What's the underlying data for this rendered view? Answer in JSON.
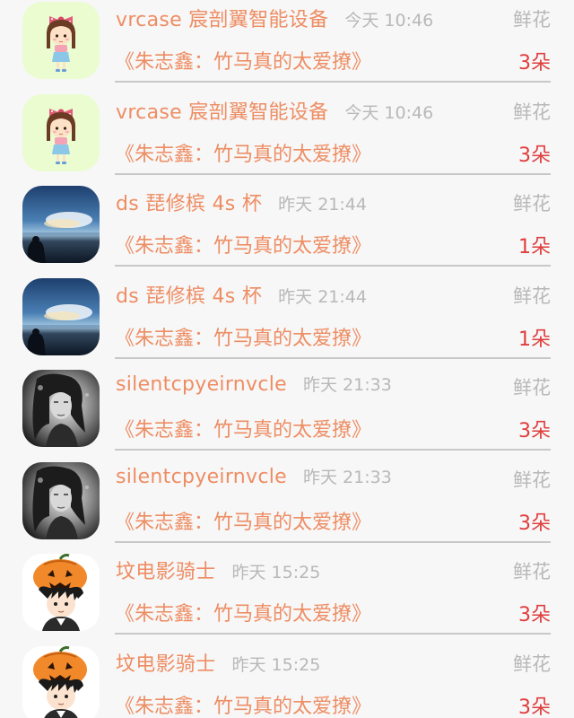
{
  "rows": [
    {
      "username": "vrcase 宸剖翼智能设备",
      "time": "今天 10:46",
      "gift": "鲜花",
      "article": "《朱志鑫：竹马真的太爱撩》",
      "count": "3朵",
      "avatar_icon": "cartoon-girl-icon"
    },
    {
      "username": "vrcase 宸剖翼智能设备",
      "time": "今天 10:46",
      "gift": "鲜花",
      "article": "《朱志鑫：竹马真的太爱撩》",
      "count": "3朵",
      "avatar_icon": "cartoon-girl-icon"
    },
    {
      "username": "ds 琵修槟 4s 杯",
      "time": "昨天 21:44",
      "gift": "鲜花",
      "article": "《朱志鑫：竹马真的太爱撩》",
      "count": "1朵",
      "avatar_icon": "sunset-sky-icon"
    },
    {
      "username": "ds 琵修槟 4s 杯",
      "time": "昨天 21:44",
      "gift": "鲜花",
      "article": "《朱志鑫：竹马真的太爱撩》",
      "count": "1朵",
      "avatar_icon": "sunset-sky-icon"
    },
    {
      "username": "silentcpyeirnvcle",
      "time": "昨天 21:33",
      "gift": "鲜花",
      "article": "《朱志鑫：竹马真的太爱撩》",
      "count": "3朵",
      "avatar_icon": "portrait-bw-icon"
    },
    {
      "username": "silentcpyeirnvcle",
      "time": "昨天 21:33",
      "gift": "鲜花",
      "article": "《朱志鑫：竹马真的太爱撩》",
      "count": "3朵",
      "avatar_icon": "portrait-bw-icon"
    },
    {
      "username": "坟电影骑士",
      "time": "昨天 15:25",
      "gift": "鲜花",
      "article": "《朱志鑫：竹马真的太爱撩》",
      "count": "3朵",
      "avatar_icon": "pumpkin-boy-icon"
    },
    {
      "username": "坟电影骑士",
      "time": "昨天 15:25",
      "gift": "鲜花",
      "article": "《朱志鑫：竹马真的太爱撩》",
      "count": "3朵",
      "avatar_icon": "pumpkin-boy-icon"
    }
  ],
  "colors": {
    "username": "#ee8d63",
    "time": "#b8b8b8",
    "count": "#e03d3d",
    "divider": "#c8c8c8",
    "background": "#f7f7f7"
  }
}
